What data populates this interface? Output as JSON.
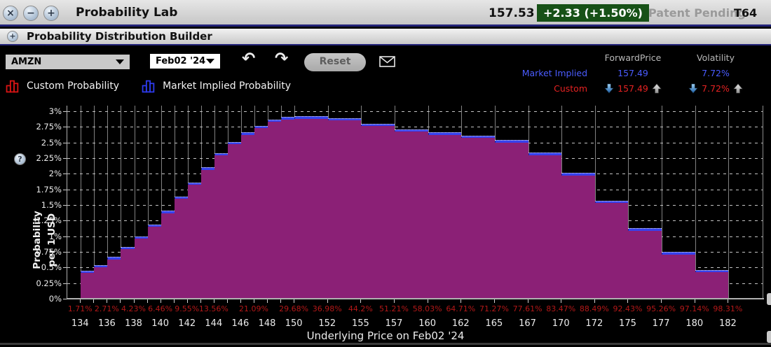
{
  "window": {
    "title": "Probability Lab",
    "buttons": {
      "close": "×",
      "minimize": "−",
      "maximize": "+"
    },
    "last_price": "157.53",
    "change": "+2.33 (+1.50%)",
    "patent_pending": "Patent Pending",
    "code": "T64",
    "badge_color": "#175117"
  },
  "panel": {
    "title": "Probability Distribution Builder",
    "expand_symbol": "+"
  },
  "toolbar": {
    "symbol_value": "AMZN",
    "expiry_value": "Feb02 '24",
    "undo_symbol": "↶",
    "redo_symbol": "↷",
    "reset_label": "Reset"
  },
  "info": {
    "headers": [
      "ForwardPrice",
      "Volatility"
    ],
    "market": {
      "label": "Market Implied",
      "forward": "157.49",
      "vol": "7.72%"
    },
    "custom": {
      "label": "Custom",
      "forward": "157.49",
      "vol": "7.72%"
    },
    "market_color": "#4a5cff",
    "custom_color": "#e52222"
  },
  "legend": {
    "items": [
      {
        "label": "Custom Probability",
        "color": "#d91414"
      },
      {
        "label": "Market Implied Probability",
        "color": "#2d3bee"
      }
    ]
  },
  "help_symbol": "?",
  "chart_data": {
    "type": "bar",
    "title": "",
    "xlabel": "Underlying Price on Feb02 '24",
    "ylabel": "Probability per 1 USD",
    "ylabel_lines": [
      "Probability",
      "per 1 USD"
    ],
    "ylim": [
      0,
      3
    ],
    "grid": "horizontal-dashed-and-vertical-solid",
    "legend_position": "top-left-outside",
    "y_ticks": [
      {
        "v": 0,
        "label": "0%"
      },
      {
        "v": 0.25,
        "label": "0.25%"
      },
      {
        "v": 0.5,
        "label": "0.5%"
      },
      {
        "v": 0.75,
        "label": "0.75%"
      },
      {
        "v": 1,
        "label": "1%"
      },
      {
        "v": 1.25,
        "label": "1.25%"
      },
      {
        "v": 1.5,
        "label": "1.5%"
      },
      {
        "v": 1.75,
        "label": "1.75%"
      },
      {
        "v": 2,
        "label": "2%"
      },
      {
        "v": 2.25,
        "label": "2.25%"
      },
      {
        "v": 2.5,
        "label": "2.5%"
      },
      {
        "v": 2.75,
        "label": "2.75%"
      },
      {
        "v": 3,
        "label": "3%"
      }
    ],
    "bar_edges": [
      134,
      135,
      136,
      137,
      138,
      139,
      140,
      141,
      142,
      143,
      144,
      145,
      146,
      147,
      148,
      149,
      150,
      152.5,
      155,
      157.5,
      160,
      162.5,
      165,
      167.5,
      170,
      172.5,
      175,
      177.5,
      180,
      182.5
    ],
    "series": [
      {
        "name": "Market Implied Probability",
        "color": "#3642ee",
        "values": [
          0.45,
          0.54,
          0.67,
          0.83,
          1.0,
          1.19,
          1.41,
          1.64,
          1.86,
          2.1,
          2.33,
          2.51,
          2.66,
          2.77,
          2.87,
          2.91,
          2.92,
          2.89,
          2.8,
          2.71,
          2.66,
          2.61,
          2.54,
          2.34,
          2.01,
          1.57,
          1.13,
          0.75,
          0.46
        ]
      },
      {
        "name": "Custom Probability",
        "color": "#8b2076",
        "values": [
          0.41,
          0.5,
          0.63,
          0.79,
          0.96,
          1.15,
          1.37,
          1.6,
          1.82,
          2.06,
          2.29,
          2.47,
          2.62,
          2.73,
          2.83,
          2.87,
          2.88,
          2.85,
          2.76,
          2.67,
          2.62,
          2.57,
          2.5,
          2.3,
          1.97,
          1.53,
          1.09,
          0.71,
          0.42
        ]
      }
    ],
    "x_ticks": [
      {
        "pos": 134,
        "label": "134"
      },
      {
        "pos": 136,
        "label": "136"
      },
      {
        "pos": 138,
        "label": "138"
      },
      {
        "pos": 140,
        "label": "140"
      },
      {
        "pos": 142,
        "label": "142"
      },
      {
        "pos": 144,
        "label": "144"
      },
      {
        "pos": 146,
        "label": "146"
      },
      {
        "pos": 148,
        "label": "148"
      },
      {
        "pos": 150,
        "label": "150"
      },
      {
        "pos": 152.5,
        "label": "152"
      },
      {
        "pos": 155,
        "label": "155"
      },
      {
        "pos": 157.5,
        "label": "157"
      },
      {
        "pos": 160,
        "label": "160"
      },
      {
        "pos": 162.5,
        "label": "162"
      },
      {
        "pos": 165,
        "label": "165"
      },
      {
        "pos": 167.5,
        "label": "167"
      },
      {
        "pos": 170,
        "label": "170"
      },
      {
        "pos": 172.5,
        "label": "172"
      },
      {
        "pos": 175,
        "label": "175"
      },
      {
        "pos": 177.5,
        "label": "177"
      },
      {
        "pos": 180,
        "label": "180"
      },
      {
        "pos": 182.5,
        "label": "182"
      }
    ],
    "cumulative_labels": [
      {
        "pos": 134,
        "text": "1.71%"
      },
      {
        "pos": 136,
        "text": "2.71%"
      },
      {
        "pos": 138,
        "text": "4.23%"
      },
      {
        "pos": 140,
        "text": "6.46%"
      },
      {
        "pos": 142,
        "text": "9.55%"
      },
      {
        "pos": 144,
        "text": "13.56%"
      },
      {
        "pos": 147,
        "text": "21.09%"
      },
      {
        "pos": 150,
        "text": "29.68%"
      },
      {
        "pos": 152.5,
        "text": "36.98%"
      },
      {
        "pos": 155,
        "text": "44.2%"
      },
      {
        "pos": 157.5,
        "text": "51.21%"
      },
      {
        "pos": 160,
        "text": "58.03%"
      },
      {
        "pos": 162.5,
        "text": "64.71%"
      },
      {
        "pos": 165,
        "text": "71.27%"
      },
      {
        "pos": 167.5,
        "text": "77.61%"
      },
      {
        "pos": 170,
        "text": "83.47%"
      },
      {
        "pos": 172.5,
        "text": "88.49%"
      },
      {
        "pos": 175,
        "text": "92.43%"
      },
      {
        "pos": 177.5,
        "text": "95.26%"
      },
      {
        "pos": 180,
        "text": "97.14%"
      },
      {
        "pos": 182.5,
        "text": "98.31%"
      }
    ]
  }
}
